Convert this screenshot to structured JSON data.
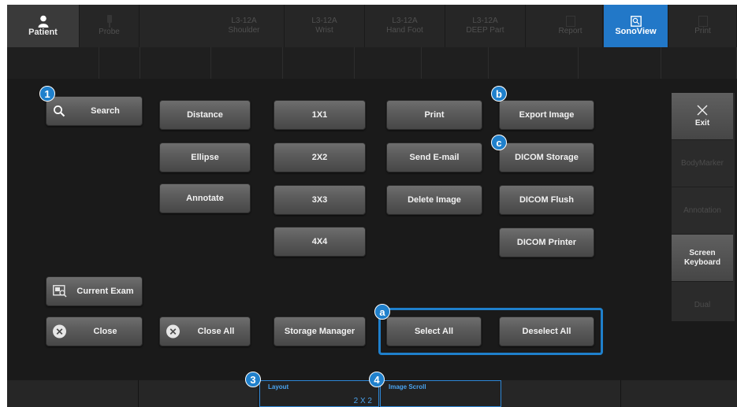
{
  "topbar": {
    "tabs": [
      {
        "label": "Patient",
        "icon": "person-icon",
        "state": "enabled"
      },
      {
        "label": "Probe",
        "icon": "probe-icon",
        "state": "disabled"
      },
      {
        "line1": "L3-12A",
        "line2": "Shoulder",
        "state": "disabled"
      },
      {
        "line1": "L3-12A",
        "line2": "Wrist",
        "state": "disabled"
      },
      {
        "line1": "L3-12A",
        "line2": "Hand Foot",
        "state": "disabled"
      },
      {
        "line1": "L3-12A",
        "line2": "DEEP Part",
        "state": "disabled"
      },
      {
        "label": "Report",
        "icon": "report-icon",
        "state": "disabled"
      },
      {
        "label": "SonoView",
        "icon": "sonoview-icon",
        "state": "active"
      },
      {
        "label": "Print",
        "icon": "print-icon",
        "state": "disabled"
      }
    ]
  },
  "buttons": {
    "search": "Search",
    "distance": "Distance",
    "ellipse": "Ellipse",
    "annotate": "Annotate",
    "layout_1x1": "1X1",
    "layout_2x2": "2X2",
    "layout_3x3": "3X3",
    "layout_4x4": "4X4",
    "print": "Print",
    "send_email": "Send E-mail",
    "delete_image": "Delete Image",
    "export_image": "Export Image",
    "dicom_storage": "DICOM Storage",
    "dicom_flush": "DICOM Flush",
    "dicom_printer": "DICOM Printer",
    "current_exam": "Current Exam",
    "close": "Close",
    "close_all": "Close All",
    "storage_manager": "Storage Manager",
    "select_all": "Select All",
    "deselect_all": "Deselect All"
  },
  "right_panel": {
    "exit": "Exit",
    "body_marker": "BodyMarker",
    "annotation": "Annotation",
    "screen_keyboard_line1": "Screen",
    "screen_keyboard_line2": "Keyboard",
    "dual": "Dual"
  },
  "callouts": {
    "c1": "1",
    "cb": "b",
    "cc": "c",
    "ca": "a",
    "c3": "3",
    "c4": "4"
  },
  "bottombar": {
    "layout_title": "Layout",
    "layout_value": "2 X 2",
    "image_scroll_title": "Image Scroll"
  },
  "colors": {
    "accent": "#1f80cc",
    "active_tab": "#2278c8",
    "background": "#1a1a1a"
  }
}
